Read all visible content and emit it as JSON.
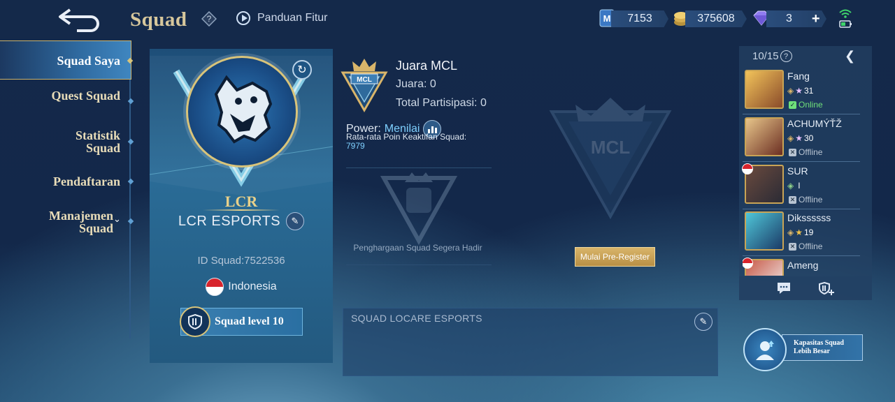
{
  "header": {
    "title": "Squad",
    "guide_label": "Panduan Fitur",
    "currencies": [
      {
        "name": "ticket",
        "value": "7153"
      },
      {
        "name": "battle-points",
        "value": "375608"
      },
      {
        "name": "diamonds",
        "value": "3"
      }
    ]
  },
  "nav": {
    "items": [
      {
        "label": "Squad Saya",
        "active": true
      },
      {
        "label": "Quest Squad",
        "active": false
      },
      {
        "label": "Statistik Squad",
        "active": false
      },
      {
        "label": "Pendaftaran",
        "active": false
      },
      {
        "label": "Manajemen Squad",
        "active": false
      }
    ]
  },
  "squad": {
    "tag": "LCR",
    "name": "LCR ESPORTS",
    "id_text": "ID Squad:7522536",
    "country": "Indonesia",
    "level": "Squad level 10",
    "description": "SQUAD LOCARE ESPORTS"
  },
  "mcl": {
    "title": "Juara MCL",
    "champion": "Juara: 0",
    "participation": "Total Partisipasi: 0",
    "power_label": "Power:",
    "power_value": "Menilai",
    "avg_label": "Rata-rata Poin Keaktifan Squad:",
    "avg_value": "7979",
    "award_text": "Penghargaan Squad Segera Hadir",
    "prereg_label": "Mulai Pre-Register"
  },
  "members": {
    "count": "10/15",
    "list": [
      {
        "name": "Fang",
        "rank": "31",
        "status": "Online"
      },
      {
        "name": "ACHUMÝŤŽ",
        "rank": "30",
        "status": "Offline"
      },
      {
        "name": "SUR",
        "rank": "I",
        "status": "Offline"
      },
      {
        "name": "Dikssssss",
        "rank": "19",
        "status": "Offline"
      },
      {
        "name": "Ameng",
        "rank": "",
        "status": ""
      }
    ]
  },
  "capacity": {
    "line1": "Kapasitas Squad",
    "line2": "Lebih Besar"
  },
  "colors": {
    "gold": "#d7c79c",
    "online": "#6fe07a",
    "offline": "#b8c4d2",
    "accent": "#7fd0ff"
  }
}
